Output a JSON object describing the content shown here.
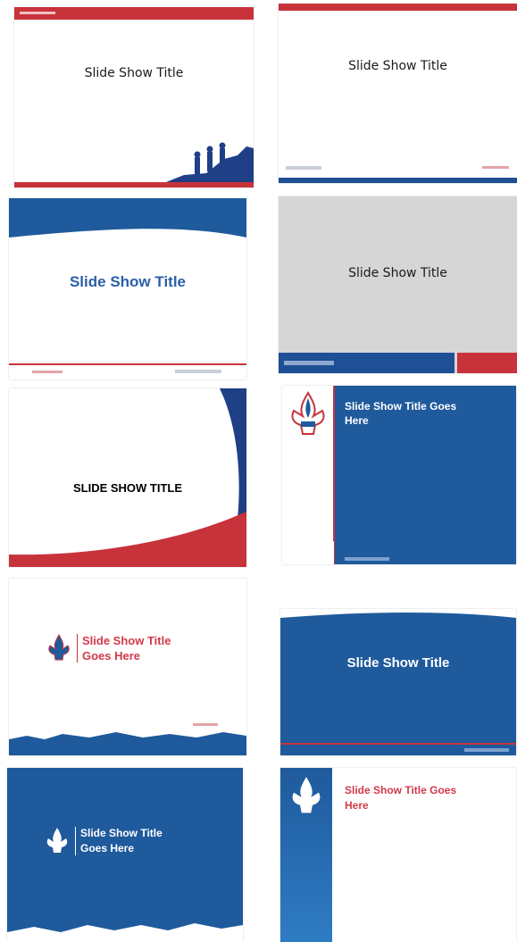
{
  "colors": {
    "blue": "#1f5a9c",
    "dark_blue": "#17457f",
    "red": "#c8333b",
    "gray": "#d6d6d6"
  },
  "slides": [
    {
      "title": "Slide Show Title",
      "title_color": "#1a1a1a"
    },
    {
      "title": "Slide Show Title",
      "title_color": "#1a1a1a"
    },
    {
      "title": "Slide Show Title",
      "title_color": "#2a5fa8"
    },
    {
      "title": "Slide Show Title",
      "title_color": "#1a1a1a"
    },
    {
      "title": "SLIDE SHOW TITLE",
      "title_color": "#000000"
    },
    {
      "title_line1": "Slide Show Title Goes",
      "title_line2": "Here",
      "title_color": "#ffffff"
    },
    {
      "title_line1": "Slide Show Title",
      "title_line2": "Goes Here",
      "title_color": "#d23a4a"
    },
    {
      "title": "Slide Show Title",
      "title_color": "#ffffff"
    },
    {
      "title_line1": "Slide Show Title",
      "title_line2": "Goes Here",
      "title_color": "#ffffff"
    },
    {
      "title_line1": "Slide Show Title Goes",
      "title_line2": "Here",
      "title_color": "#d23a4a"
    }
  ]
}
